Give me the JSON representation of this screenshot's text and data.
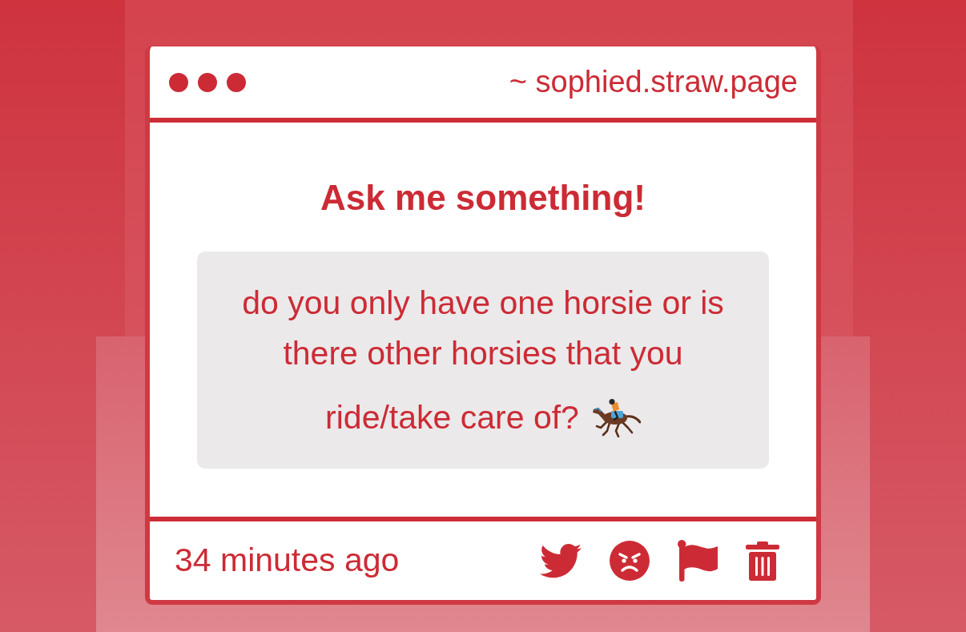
{
  "window": {
    "address": "~ sophied.straw.page"
  },
  "prompt": {
    "title": "Ask me something!"
  },
  "question": {
    "lines": [
      "do you only have one horsie or is",
      "there other horsies that you",
      "ride/take care of?"
    ]
  },
  "footer": {
    "time": "34 minutes ago"
  }
}
